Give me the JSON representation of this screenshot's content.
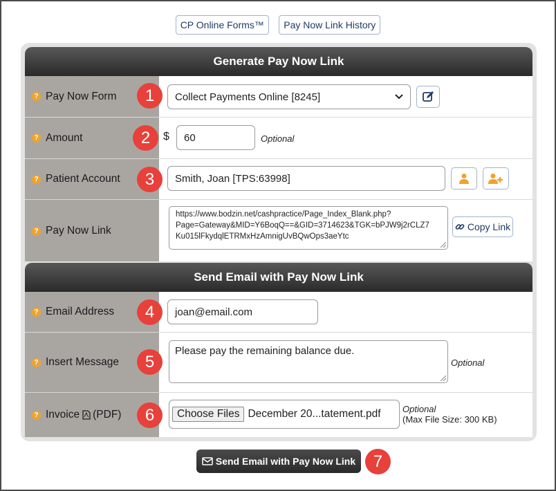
{
  "top_buttons": {
    "online_forms": "CP Online Forms™",
    "history": "Pay Now Link History"
  },
  "generate_section": {
    "title": "Generate Pay Now Link",
    "pay_now_form": {
      "label": "Pay Now Form",
      "value": "Collect Payments Online [8245]"
    },
    "amount": {
      "label": "Amount",
      "currency": "$",
      "value": "60",
      "optional": "Optional"
    },
    "patient_account": {
      "label": "Patient Account",
      "value": "Smith, Joan [TPS:63998]"
    },
    "pay_now_link": {
      "label": "Pay Now Link",
      "line1": "https://www.bodzin.net/cashpractice/Page_Index_Blank.php?",
      "line2": "Page=Gateway&MID=Y6BoqQ==&GID=3714623&TGK=bPJW9j2rCLZ7",
      "line3": "Ku015lFkydqlETRMxHzAmnigUvBQwOps3aeYtc",
      "copy_label": "Copy Link"
    }
  },
  "email_section": {
    "title": "Send Email with Pay Now Link",
    "email": {
      "label": "Email Address",
      "value": "joan@email.com"
    },
    "message": {
      "label": "Insert Message",
      "value": "Please pay the remaining balance due.",
      "optional": "Optional"
    },
    "invoice": {
      "label_prefix": "Invoice",
      "label_suffix": "(PDF)",
      "choose_label": "Choose Files",
      "file_name": "December 20...tatement.pdf",
      "optional": "Optional",
      "max_size": "(Max File Size: 300 KB)"
    }
  },
  "send_button": {
    "label": "Send Email with Pay Now Link"
  },
  "badges": [
    "1",
    "2",
    "3",
    "4",
    "5",
    "6",
    "7"
  ],
  "colors": {
    "badge": "#e8403a",
    "help_icon": "#f0a32a",
    "label_bg": "#a9a6a2",
    "accent": "#f0a32a",
    "header": "#333333"
  },
  "icons": {
    "help": "question-circle-icon",
    "edit": "edit-icon",
    "user": "user-icon",
    "add_user": "user-plus-icon",
    "link": "link-icon",
    "pdf": "pdf-file-icon",
    "envelope": "envelope-icon"
  }
}
